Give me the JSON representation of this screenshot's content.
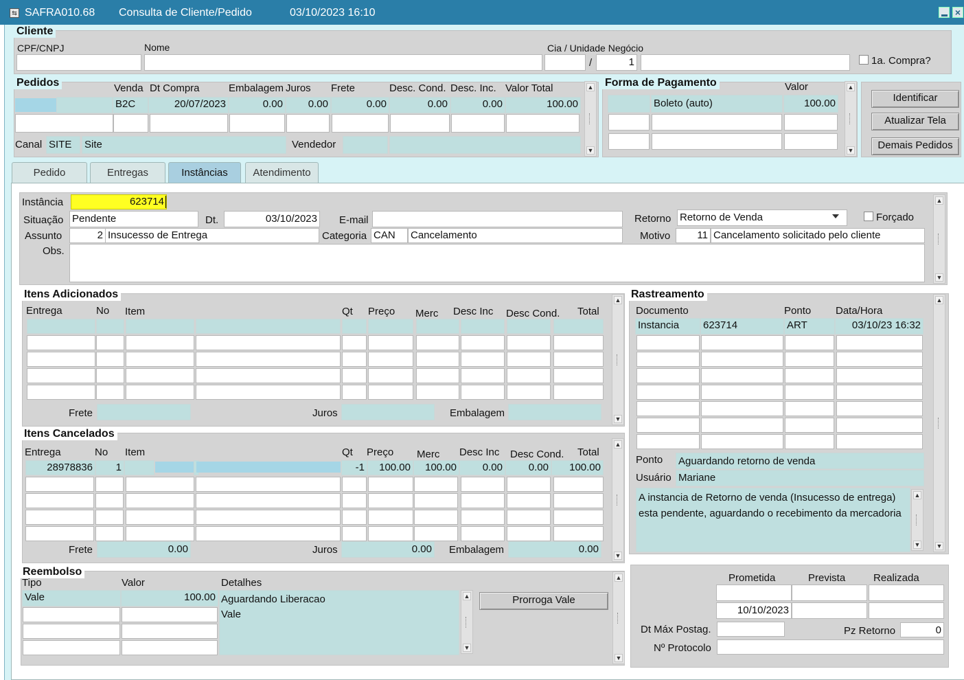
{
  "window": {
    "title_code": "SAFRA010.68",
    "title_name": "Consulta de Cliente/Pedido",
    "title_datetime": "03/10/2023 16:10"
  },
  "cliente": {
    "section": "Cliente",
    "cpf_label": "CPF/CNPJ",
    "nome_label": "Nome",
    "cia_label": "Cia / Unidade Negócio",
    "cia_sep": "/",
    "unidade_value": "1",
    "primeira_compra_label": "1a. Compra?"
  },
  "pedidos": {
    "section": "Pedidos",
    "headers": {
      "venda": "Venda",
      "dt_compra": "Dt Compra",
      "embalagem": "Embalagem",
      "juros": "Juros",
      "frete": "Frete",
      "desc_cond": "Desc. Cond.",
      "desc_inc": "Desc. Inc.",
      "valor_total": "Valor Total"
    },
    "row": {
      "venda": "B2C",
      "dt_compra": "20/07/2023",
      "embalagem": "0.00",
      "juros": "0.00",
      "frete": "0.00",
      "desc_cond": "0.00",
      "desc_inc": "0.00",
      "valor_total": "100.00"
    },
    "canal_label": "Canal",
    "canal_code": "SITE",
    "canal_name": "Site",
    "vendedor_label": "Vendedor"
  },
  "pagamento": {
    "section": "Forma de Pagamento",
    "valor_label": "Valor",
    "forma": "Boleto (auto)",
    "valor": "100.00"
  },
  "buttons": {
    "identificar": "Identificar",
    "atualizar": "Atualizar Tela",
    "demais": "Demais Pedidos",
    "prorroga": "Prorroga Vale"
  },
  "tabs": [
    {
      "label": "Pedido",
      "active": false
    },
    {
      "label": "Entregas",
      "active": false
    },
    {
      "label": "Instâncias",
      "active": true
    },
    {
      "label": "Atendimento",
      "active": false
    }
  ],
  "instancia": {
    "instancia_label": "Instância",
    "instancia_value": "623714",
    "situacao_label": "Situação",
    "situacao_value": "Pendente",
    "dt_label": "Dt.",
    "dt_value": "03/10/2023",
    "email_label": "E-mail",
    "retorno_label": "Retorno",
    "retorno_value": "Retorno de Venda",
    "forcado_label": "Forçado",
    "assunto_label": "Assunto",
    "assunto_code": "2",
    "assunto_desc": "Insucesso de Entrega",
    "categoria_label": "Categoria",
    "categoria_code": "CAN",
    "categoria_desc": "Cancelamento",
    "motivo_label": "Motivo",
    "motivo_code": "11",
    "motivo_desc": "Cancelamento solicitado pelo cliente",
    "obs_label": "Obs."
  },
  "itens_adicionados": {
    "section": "Itens Adicionados",
    "headers": {
      "entrega": "Entrega",
      "no": "No",
      "item": "Item",
      "qt": "Qt",
      "preco": "Preço",
      "merc": "Merc",
      "desc_inc": "Desc Inc",
      "desc_cond": "Desc Cond.",
      "total": "Total"
    },
    "frete_label": "Frete",
    "juros_label": "Juros",
    "embalagem_label": "Embalagem"
  },
  "itens_cancelados": {
    "section": "Itens Cancelados",
    "headers": {
      "entrega": "Entrega",
      "no": "No",
      "item": "Item",
      "qt": "Qt",
      "preco": "Preço",
      "merc": "Merc",
      "desc_inc": "Desc Inc",
      "desc_cond": "Desc Cond.",
      "total": "Total"
    },
    "row": {
      "entrega": "28978836",
      "no": "1",
      "qt": "-1",
      "preco": "100.00",
      "merc": "100.00",
      "desc_inc": "0.00",
      "desc_cond": "0.00",
      "total": "100.00"
    },
    "frete_label": "Frete",
    "frete_value": "0.00",
    "juros_label": "Juros",
    "juros_value": "0.00",
    "embalagem_label": "Embalagem",
    "embalagem_value": "0.00"
  },
  "reembolso": {
    "section": "Reembolso",
    "tipo_label": "Tipo",
    "valor_label": "Valor",
    "detalhes_label": "Detalhes",
    "tipo": "Vale",
    "valor": "100.00",
    "detalhes_line1": "Aguardando Liberacao",
    "detalhes_line2": "Vale"
  },
  "rastreamento": {
    "section": "Rastreamento",
    "headers": {
      "documento": "Documento",
      "ponto": "Ponto",
      "data_hora": "Data/Hora"
    },
    "row": {
      "documento": "Instancia",
      "numero": "623714",
      "ponto": "ART",
      "data_hora": "03/10/23 16:32"
    },
    "ponto_label": "Ponto",
    "ponto_value": "Aguardando retorno de venda",
    "usuario_label": "Usuário",
    "usuario_value": "Mariane",
    "mensagem": "A instancia de Retorno de venda (Insucesso de entrega) esta pendente, aguardando o recebimento da mercadoria"
  },
  "prazos": {
    "prometida_label": "Prometida",
    "prevista_label": "Prevista",
    "realizada_label": "Realizada",
    "prometida_value": "10/10/2023",
    "dt_max_label": "Dt Máx Postag.",
    "pz_retorno_label": "Pz Retorno",
    "pz_retorno_value": "0",
    "protocolo_label": "Nº Protocolo"
  },
  "colors": {
    "titlebar": "#2a7ea8",
    "frame": "#d7f3f6",
    "panel": "#d4d4d4",
    "teal_field": "#bfdfdf",
    "selected_row": "#a5d6e6",
    "focus_field": "#ffff22"
  }
}
